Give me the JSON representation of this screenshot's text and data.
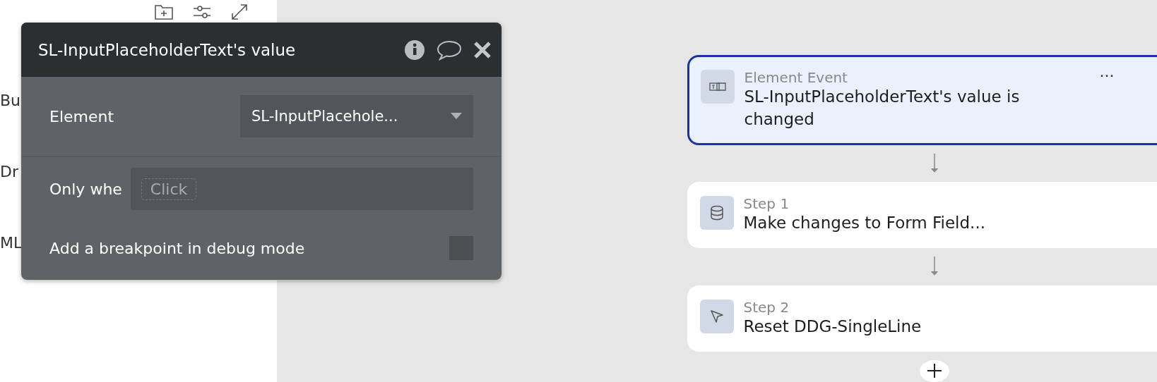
{
  "side_labels": [
    "Bu",
    "Dr",
    "ML"
  ],
  "popup": {
    "title": "SL-InputPlaceholderText's value",
    "element_label": "Element",
    "element_value": "SL-InputPlacehole...",
    "condition_label": "Only whe",
    "condition_placeholder": "Click",
    "breakpoint_label": "Add a breakpoint in debug mode",
    "breakpoint_checked": false
  },
  "workflow": [
    {
      "kind": "event",
      "selected": true,
      "label": "Element Event",
      "title": "SL-InputPlaceholderText's value is changed",
      "menu": "···"
    },
    {
      "kind": "data",
      "selected": false,
      "label": "Step 1",
      "title": "Make changes to Form Field..."
    },
    {
      "kind": "action",
      "selected": false,
      "label": "Step 2",
      "title": "Reset DDG-SingleLine"
    }
  ]
}
